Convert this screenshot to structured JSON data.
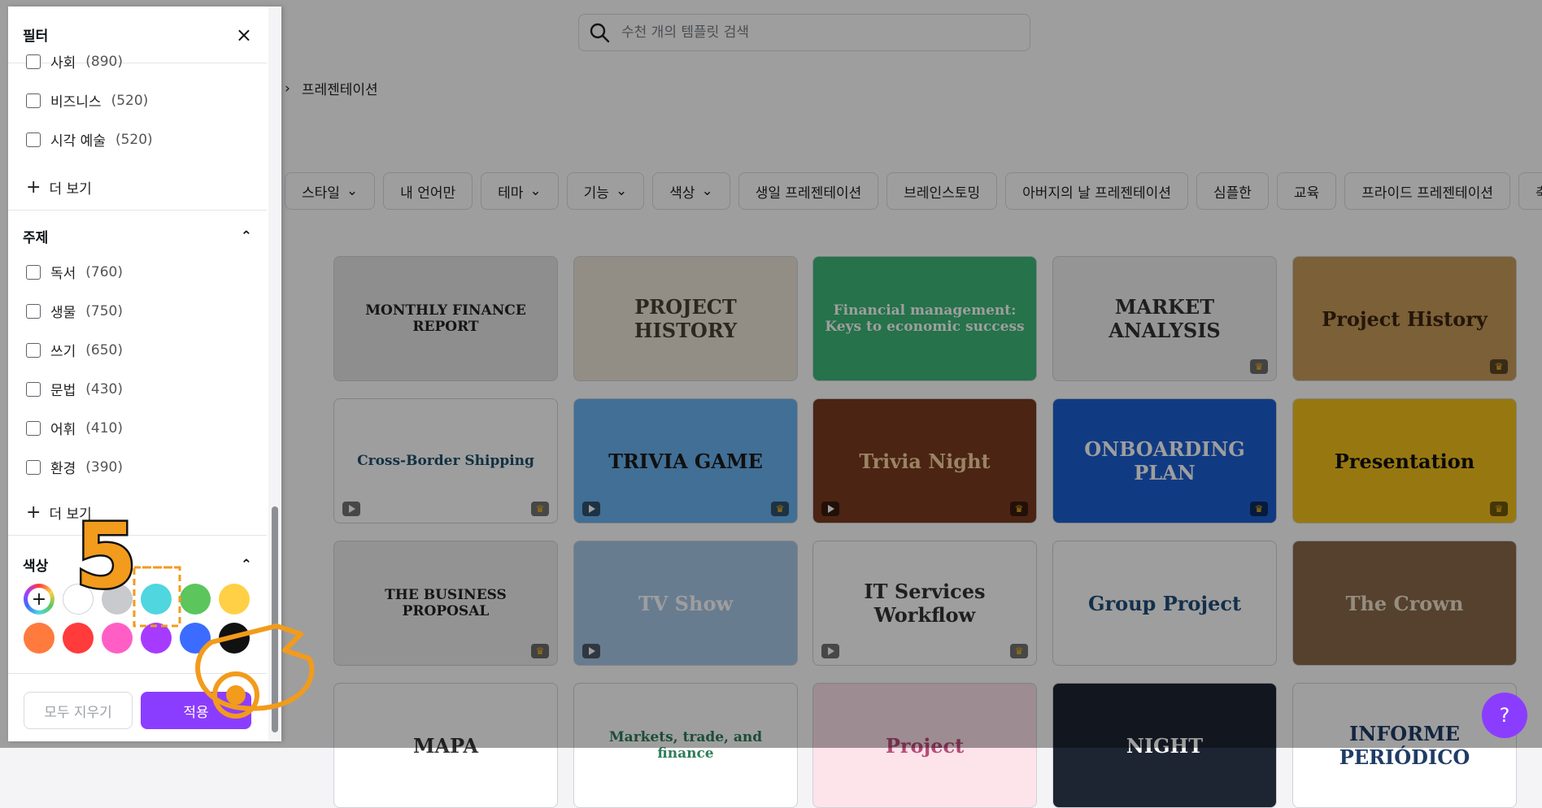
{
  "search": {
    "placeholder": "수천 개의 템플릿 검색"
  },
  "breadcrumb": {
    "current": "프레젠테이션"
  },
  "chips": [
    {
      "label": "스타일",
      "dropdown": true
    },
    {
      "label": "내 언어만",
      "dropdown": false
    },
    {
      "label": "테마",
      "dropdown": true
    },
    {
      "label": "기능",
      "dropdown": true
    },
    {
      "label": "색상",
      "dropdown": true
    },
    {
      "label": "생일 프레젠테이션",
      "dropdown": false
    },
    {
      "label": "브레인스토밍",
      "dropdown": false
    },
    {
      "label": "아버지의 날 프레젠테이션",
      "dropdown": false
    },
    {
      "label": "심플한",
      "dropdown": false
    },
    {
      "label": "교육",
      "dropdown": false
    },
    {
      "label": "프라이드 프레젠테이션",
      "dropdown": false
    },
    {
      "label": "축하 프",
      "dropdown": false
    }
  ],
  "templates": [
    {
      "title": "MONTHLY FINANCE REPORT",
      "bg": "#e6e6e6",
      "fg": "#222222"
    },
    {
      "title": "PROJECT HISTORY",
      "bg": "#ece6d8",
      "fg": "#4a4030"
    },
    {
      "title": "Financial management: Keys to economic success",
      "bg": "#3db87a",
      "fg": "#ffffff"
    },
    {
      "title": "MARKET ANALYSIS",
      "bg": "#f0f0f0",
      "fg": "#333333",
      "premium": true
    },
    {
      "title": "Project History",
      "bg": "#c99b5a",
      "fg": "#3a2410",
      "premium": true
    },
    {
      "title": "Cross-Border Shipping",
      "bg": "#ffffff",
      "fg": "#1d4f6b",
      "video": true,
      "premium": true
    },
    {
      "title": "TRIVIA GAME",
      "bg": "#6ab4f0",
      "fg": "#1a1a1a",
      "video": true,
      "premium": true
    },
    {
      "title": "Trivia Night",
      "bg": "#7a3b1f",
      "fg": "#f7d6a0",
      "video": true,
      "premium": true
    },
    {
      "title": "ONBOARDING PLAN",
      "bg": "#1a5fd4",
      "fg": "#ffffff",
      "premium": true
    },
    {
      "title": "Presentation",
      "bg": "#f4c21b",
      "fg": "#111111",
      "premium": true
    },
    {
      "title": "THE BUSINESS PROPOSAL",
      "bg": "#ededed",
      "fg": "#222222",
      "premium": true
    },
    {
      "title": "TV Show",
      "bg": "#a9c8e8",
      "fg": "#ffffff",
      "video": true
    },
    {
      "title": "IT Services Workflow",
      "bg": "#ffffff",
      "fg": "#333333",
      "video": true,
      "premium": true
    },
    {
      "title": "Group Project",
      "bg": "#ffffff",
      "fg": "#1f4e7a"
    },
    {
      "title": "The Crown",
      "bg": "#8a6a4a",
      "fg": "#f1e4cf"
    },
    {
      "title": "MAPA",
      "bg": "#ffffff",
      "fg": "#333333"
    },
    {
      "title": "Markets, trade, and finance",
      "bg": "#ffffff",
      "fg": "#2e7d5b"
    },
    {
      "title": "Project",
      "bg": "#fde3ea",
      "fg": "#b64d77"
    },
    {
      "title": "NIGHT",
      "bg": "#1d2432",
      "fg": "#ffffff"
    },
    {
      "title": "INFORME PERIÓDICO",
      "bg": "#ffffff",
      "fg": "#1f3c66"
    }
  ],
  "panel": {
    "title": "필터",
    "close_icon": "×",
    "category_items": [
      {
        "label": "사회",
        "count": "(890)"
      },
      {
        "label": "비즈니스",
        "count": "(520)"
      },
      {
        "label": "시각 예술",
        "count": "(520)"
      }
    ],
    "more_label_1": "더 보기",
    "subject_title": "주제",
    "subject_items": [
      {
        "label": "독서",
        "count": "(760)"
      },
      {
        "label": "생물",
        "count": "(750)"
      },
      {
        "label": "쓰기",
        "count": "(650)"
      },
      {
        "label": "문법",
        "count": "(430)"
      },
      {
        "label": "어휘",
        "count": "(410)"
      },
      {
        "label": "환경",
        "count": "(390)"
      }
    ],
    "more_label_2": "더 보기",
    "color_title": "색상",
    "colors": [
      "#ffffff",
      "#c8cacd",
      "#4fd6de",
      "#5cc55c",
      "#ffd046",
      "#ff7a3d",
      "#ff3b3b",
      "#ff5fc5",
      "#a63bff",
      "#3b6cff",
      "#111111"
    ],
    "clear_label": "모두 지우기",
    "apply_label": "적용"
  },
  "annotation": {
    "step_number": "5"
  },
  "help": {
    "label": "?"
  }
}
